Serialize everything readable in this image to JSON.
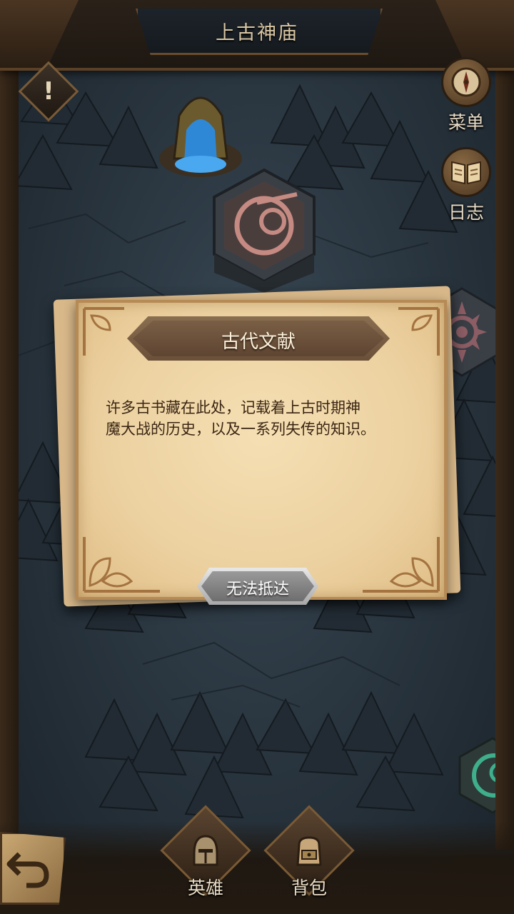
{
  "map": {
    "title": "上古神庙"
  },
  "alert": {
    "symbol": "!",
    "icon": "alert-icon"
  },
  "side_menu": {
    "menu_label": "菜单",
    "menu_icon": "compass-icon",
    "journal_label": "日志",
    "journal_icon": "book-icon"
  },
  "nodes": {
    "temple_icon": "spring-shrine-icon",
    "rune_icon": "crescent-rune-icon",
    "gear_icon": "sun-gear-icon",
    "green_rune_icon": "green-rune-icon"
  },
  "dialog": {
    "title": "古代文献",
    "body_line1": "许多古书藏在此处，记载着上古时期神",
    "body_line2": "魔大战的历史，以及一系列失传的知识。",
    "button_label": "无法抵达"
  },
  "bottom_bar": {
    "back_icon": "return-arrow-icon",
    "hero_label": "英雄",
    "hero_icon": "helmet-icon",
    "bag_label": "背包",
    "bag_icon": "backpack-icon"
  },
  "colors": {
    "parchment": "#ecd1a0",
    "banner": "#6b5039",
    "frame_wood": "#5a4027",
    "map_stone": "#2a3640",
    "button_gray": "#8a8a8a",
    "rune_red": "#c58a82",
    "rune_green": "#3fae8a"
  }
}
